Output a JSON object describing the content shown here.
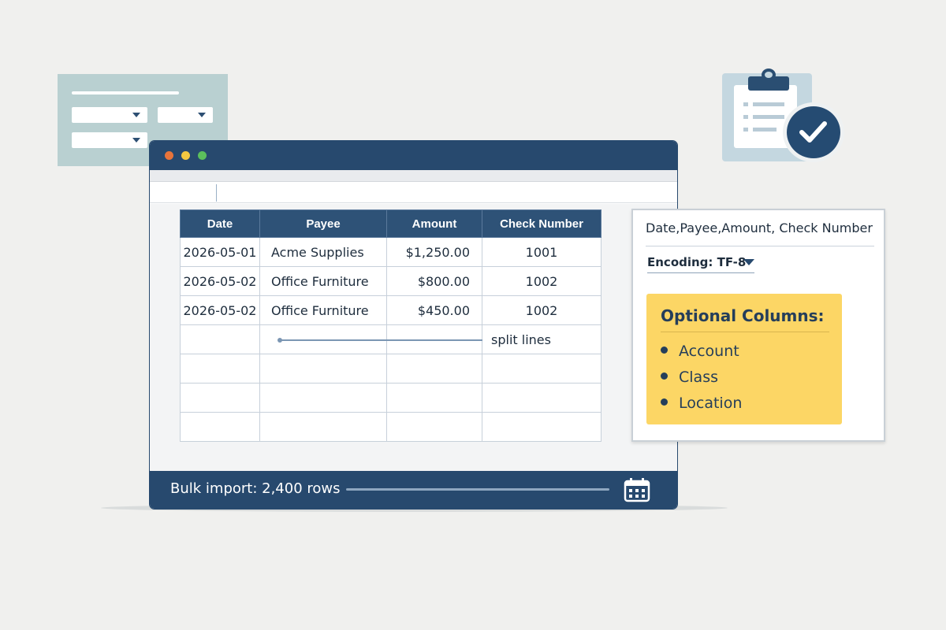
{
  "table": {
    "headers": [
      "Date",
      "Payee",
      "Amount",
      "Check Number"
    ],
    "rows": [
      [
        "2026-05-01",
        "Acme Supplies",
        "$1,250.00",
        "1001"
      ],
      [
        "2026-05-02",
        "Office Furniture",
        "$800.00",
        "1002"
      ],
      [
        "2026-05-02",
        "Office Furniture",
        "$450.00",
        "1002"
      ]
    ],
    "split_label": "split lines"
  },
  "statusbar": {
    "text": "Bulk import: 2,400 rows"
  },
  "panel": {
    "header": "Date,Payee,Amount, Check Number",
    "encoding": "Encoding: TF-8",
    "optional_title": "Optional Columns:",
    "optional_items": [
      "Account",
      "Class",
      "Location"
    ]
  },
  "colors": {
    "navy": "#27496e",
    "header_blue": "#2e5277",
    "highlight_yellow": "#fcd665",
    "dot_red": "#e8743b",
    "dot_yellow": "#f3c841",
    "dot_green": "#5cbf5c"
  },
  "icons": [
    "clipboard-icon",
    "checkmark-icon",
    "calendar-icon",
    "dropdown-arrow-icon"
  ]
}
